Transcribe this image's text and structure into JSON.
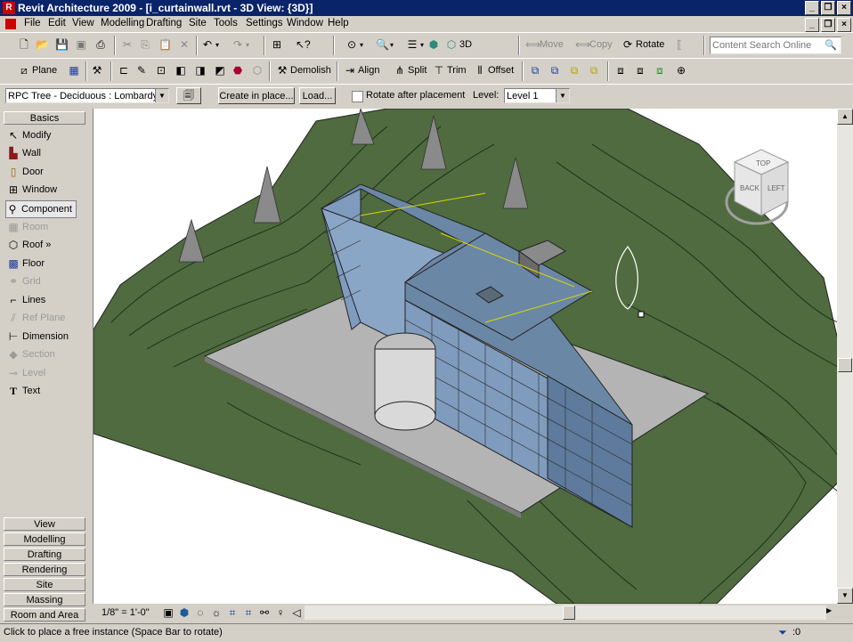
{
  "window": {
    "title": "Revit Architecture 2009 - [i_curtainwall.rvt - 3D View: {3D}]",
    "app_icon": "R"
  },
  "menu": [
    "File",
    "Edit",
    "View",
    "Modelling",
    "Drafting",
    "Site",
    "Tools",
    "Settings",
    "Window",
    "Help"
  ],
  "toolbar1": {
    "move": "Move",
    "copy": "Copy",
    "rotate": "Rotate",
    "threed": "3D",
    "search_placeholder": "Content Search Online"
  },
  "toolbar2": {
    "plane": "Plane",
    "demolish": "Demolish",
    "align": "Align",
    "split": "Split",
    "trim": "Trim",
    "offset": "Offset"
  },
  "options_bar": {
    "family_type": "RPC Tree - Deciduous : Lombardy Po",
    "create_in_place": "Create in place...",
    "load": "Load...",
    "rotate_after_placement": "Rotate after placement",
    "level_label": "Level:",
    "level_value": "Level 1"
  },
  "design_bar": {
    "active_tab": "Basics",
    "items": [
      {
        "label": "Modify",
        "icon": "arrow-icon",
        "enabled": true
      },
      {
        "label": "Wall",
        "icon": "wall-icon",
        "enabled": true
      },
      {
        "label": "Door",
        "icon": "door-icon",
        "enabled": true
      },
      {
        "label": "Window",
        "icon": "window-icon",
        "enabled": true
      },
      {
        "label": "Component",
        "icon": "component-icon",
        "enabled": true,
        "selected": true
      },
      {
        "label": "Room",
        "icon": "room-icon",
        "enabled": false
      },
      {
        "label": "Roof »",
        "icon": "roof-icon",
        "enabled": true
      },
      {
        "label": "Floor",
        "icon": "floor-icon",
        "enabled": true
      },
      {
        "label": "Grid",
        "icon": "grid-icon",
        "enabled": false
      },
      {
        "label": "Lines",
        "icon": "lines-icon",
        "enabled": true
      },
      {
        "label": "Ref Plane",
        "icon": "ref-plane-icon",
        "enabled": false
      },
      {
        "label": "Dimension",
        "icon": "dimension-icon",
        "enabled": true
      },
      {
        "label": "Section",
        "icon": "section-icon",
        "enabled": false
      },
      {
        "label": "Level",
        "icon": "level-icon",
        "enabled": false
      },
      {
        "label": "Text",
        "icon": "text-icon",
        "enabled": true
      }
    ],
    "tabs": [
      "View",
      "Modelling",
      "Drafting",
      "Rendering",
      "Site",
      "Massing",
      "Room and Area"
    ]
  },
  "viewcube": {
    "top": "TOP",
    "back": "BACK",
    "left": "LEFT"
  },
  "view_control": {
    "scale": "1/8\" = 1'-0\""
  },
  "status": {
    "message": "Click to place a free instance (Space Bar to rotate)",
    "filter_count": ":0"
  },
  "colors": {
    "titlebar": "#0a246a",
    "terrain": "#4f6b3f",
    "pad": "#b4b4b4",
    "glass": "#7f9bbd",
    "roof": "#6a87a6"
  }
}
